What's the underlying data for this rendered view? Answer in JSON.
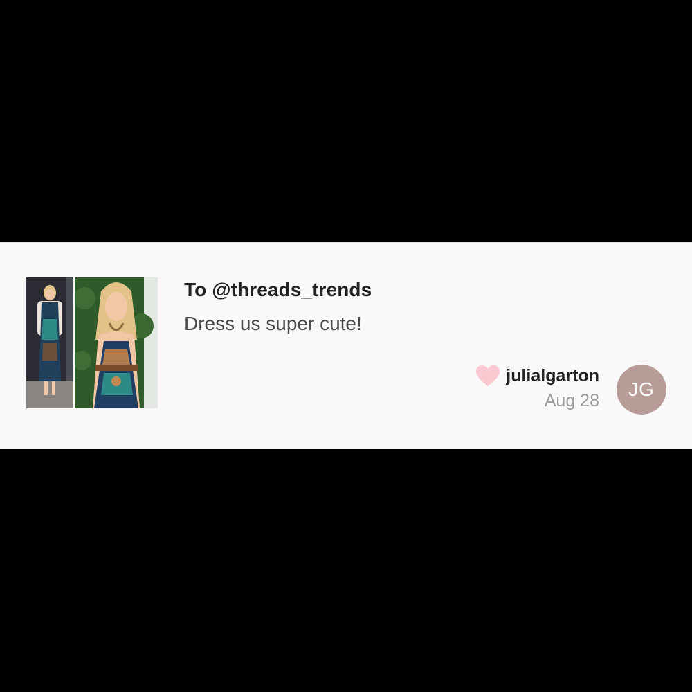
{
  "message_card": {
    "title": "To @threads_trends",
    "body": "Dress us super cute!",
    "author": {
      "username": "julialgarton",
      "date": "Aug 28",
      "initials": "JG"
    },
    "like_icon": "heart-icon",
    "colors": {
      "background": "#000000",
      "card": "#faf8f9",
      "heart": "#f9c8d0",
      "avatar": "#b89c97"
    }
  }
}
